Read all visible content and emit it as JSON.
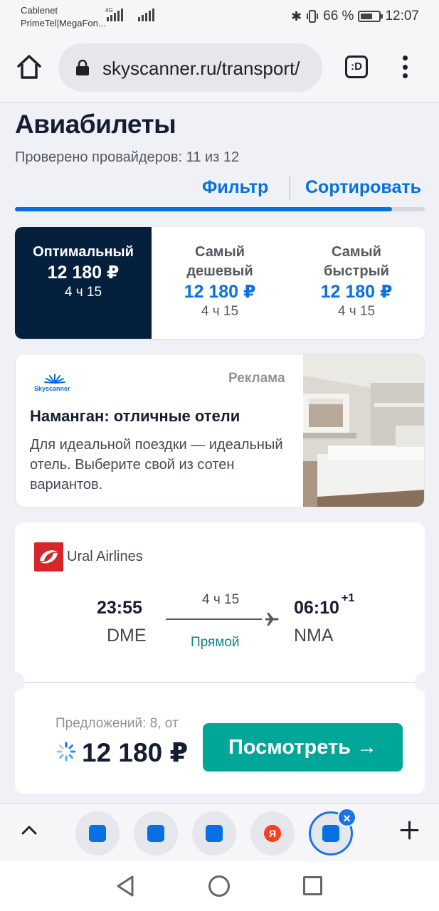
{
  "status_bar": {
    "carrier1": "Cablenet",
    "carrier2": "PrimeTel|MegaFon...",
    "network_type": "4G",
    "battery": "66 %",
    "battery_level": 0.66,
    "time": "12:07"
  },
  "browser": {
    "url": "skyscanner.ru/transport/",
    "tab_icon_label": ":D"
  },
  "page": {
    "title": "Авиабилеты",
    "providers_checked": "Проверено провайдеров: 11 из 12",
    "filter_label": "Фильтр",
    "sort_label": "Сортировать",
    "progress": 0.92
  },
  "sort_tabs": [
    {
      "name_line1": "Оптимальный",
      "name_line2": "",
      "price": "12 180 ₽",
      "duration": "4 ч 15",
      "active": true
    },
    {
      "name_line1": "Самый",
      "name_line2": "дешевый",
      "price": "12 180 ₽",
      "duration": "4 ч 15",
      "active": false
    },
    {
      "name_line1": "Самый",
      "name_line2": "быстрый",
      "price": "12 180 ₽",
      "duration": "4 ч 15",
      "active": false
    }
  ],
  "ad": {
    "logo_text": "Skyscanner",
    "label": "Реклама",
    "title": "Наманган: отличные отели",
    "text": "Для идеальной поездки — идеальный отель. Выберите свой из сотен вариантов."
  },
  "flight": {
    "airline": "Ural Airlines",
    "departure_time": "23:55",
    "departure_code": "DME",
    "duration": "4 ч 15",
    "stops": "Прямой",
    "arrival_time": "06:10",
    "arrival_day_offset": "+1",
    "arrival_code": "NMA",
    "offers": "Предложений: 8, от",
    "price": "12 180 ₽",
    "button_label": "Посмотреть →"
  },
  "tab_strip": {
    "yandex_letter": "Я"
  },
  "colors": {
    "brand_blue": "#0770e3",
    "dark_navy": "#05203c",
    "cta_green": "#00a698",
    "direct_teal": "#0c838a"
  }
}
